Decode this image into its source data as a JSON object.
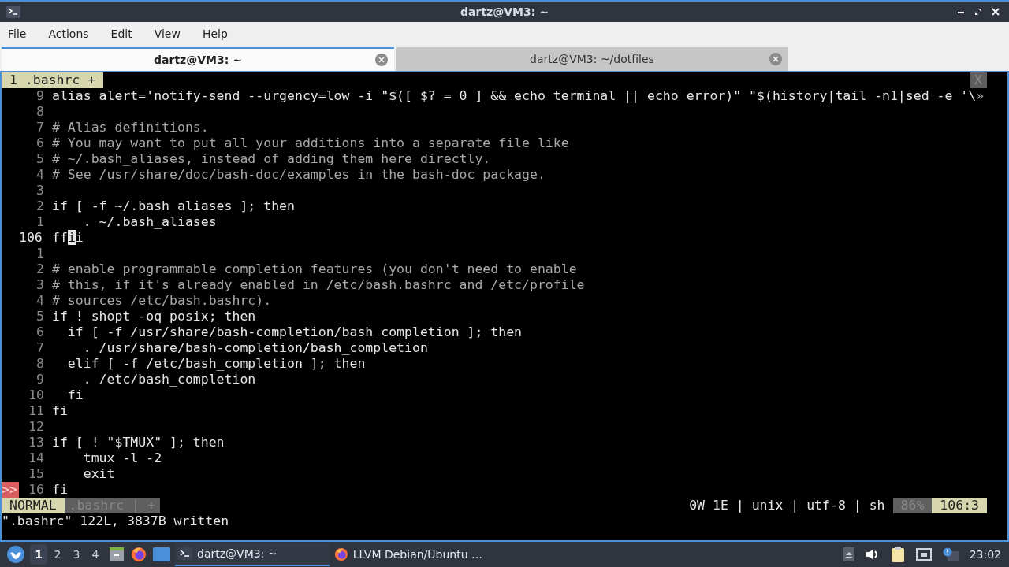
{
  "window": {
    "title": "dartz@VM3: ~"
  },
  "menu": [
    "File",
    "Actions",
    "Edit",
    "View",
    "Help"
  ],
  "tabs": [
    {
      "label": "dartz@VM3: ~",
      "selected": true
    },
    {
      "label": "dartz@VM3: ~/dotfiles",
      "selected": false
    }
  ],
  "vim": {
    "tabline": {
      "label": "1 .bashrc +",
      "close": "X"
    },
    "lines": [
      {
        "number": "9",
        "kind": "code",
        "text": "alias alert='notify-send --urgency=low -i \"$([ $? = 0 ] && echo terminal || echo error)\" \"$(history|tail -n1|sed -e '\\",
        "overflow": "»"
      },
      {
        "number": "8",
        "kind": "blank"
      },
      {
        "number": "7",
        "kind": "comment",
        "text": "# Alias definitions."
      },
      {
        "number": "6",
        "kind": "comment",
        "text": "# You may want to put all your additions into a separate file like"
      },
      {
        "number": "5",
        "kind": "comment",
        "text": "# ~/.bash_aliases, instead of adding them here directly."
      },
      {
        "number": "4",
        "kind": "comment",
        "text": "# See /usr/share/doc/bash-doc/examples in the bash-doc package."
      },
      {
        "number": "3",
        "kind": "blank"
      },
      {
        "number": "2",
        "kind": "code",
        "text": "if [ -f ~/.bash_aliases ]; then"
      },
      {
        "number": "1",
        "kind": "code",
        "text": "    . ~/.bash_aliases"
      },
      {
        "number": "106",
        "kind": "cursor",
        "text": "ff",
        "cursor_char": "i",
        "after": "i"
      },
      {
        "number": "1",
        "kind": "blank"
      },
      {
        "number": "2",
        "kind": "comment",
        "text": "# enable programmable completion features (you don't need to enable"
      },
      {
        "number": "3",
        "kind": "comment",
        "text": "# this, if it's already enabled in /etc/bash.bashrc and /etc/profile"
      },
      {
        "number": "4",
        "kind": "comment",
        "text": "# sources /etc/bash.bashrc)."
      },
      {
        "number": "5",
        "kind": "code",
        "text": "if ! shopt -oq posix; then"
      },
      {
        "number": "6",
        "kind": "code",
        "text": "  if [ -f /usr/share/bash-completion/bash_completion ]; then"
      },
      {
        "number": "7",
        "kind": "code",
        "text": "    . /usr/share/bash-completion/bash_completion"
      },
      {
        "number": "8",
        "kind": "code",
        "text": "  elif [ -f /etc/bash_completion ]; then"
      },
      {
        "number": "9",
        "kind": "code",
        "text": "    . /etc/bash_completion"
      },
      {
        "number": "10",
        "kind": "code",
        "text": "  fi"
      },
      {
        "number": "11",
        "kind": "code",
        "text": "fi"
      },
      {
        "number": "12",
        "kind": "blank"
      },
      {
        "number": "13",
        "kind": "code",
        "text": "if [ ! \"$TMUX\" ]; then"
      },
      {
        "number": "14",
        "kind": "code",
        "text": "    tmux -l -2"
      },
      {
        "number": "15",
        "kind": "code",
        "text": "    exit"
      },
      {
        "number": "16",
        "kind": "code",
        "text": "fi",
        "sign": ">>"
      }
    ],
    "statusline": {
      "mode": "NORMAL",
      "file": ".bashrc | +",
      "info": "0W 1E | unix | utf-8 | sh",
      "percent": "86%",
      "position": "106:3"
    },
    "message": "\".bashrc\" 122L, 3837B written"
  },
  "taskbar": {
    "workspaces": [
      {
        "label": "1",
        "selected": true
      },
      {
        "label": "2",
        "selected": false
      },
      {
        "label": "3",
        "selected": false
      },
      {
        "label": "4",
        "selected": false
      }
    ],
    "tasks": [
      {
        "label": "dartz@VM3: ~",
        "kind": "terminal",
        "selected": true
      },
      {
        "label": "LLVM Debian/Ubuntu …",
        "kind": "browser",
        "selected": false
      }
    ],
    "clock": "23:02"
  }
}
